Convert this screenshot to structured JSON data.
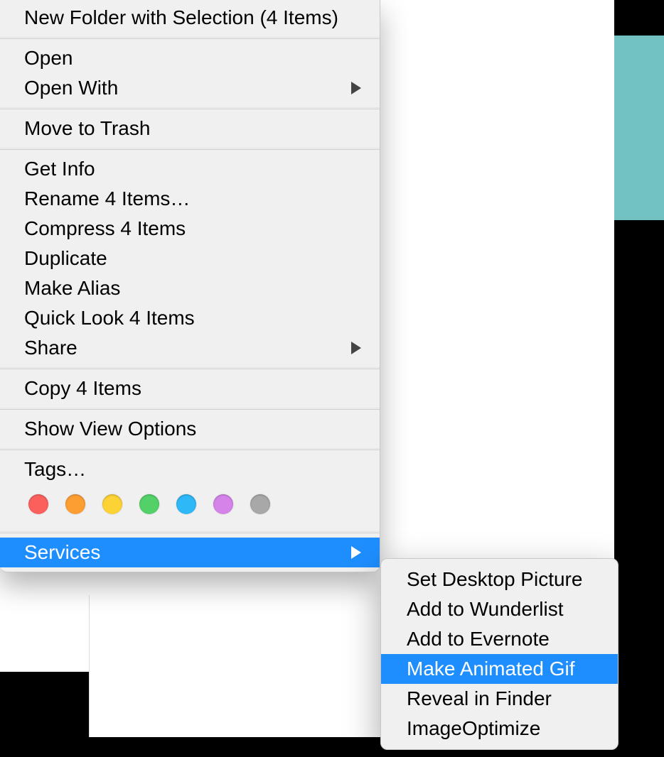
{
  "mainMenu": {
    "newFolder": "New Folder with Selection (4 Items)",
    "open": "Open",
    "openWith": "Open With",
    "moveToTrash": "Move to Trash",
    "getInfo": "Get Info",
    "rename": "Rename 4 Items…",
    "compress": "Compress 4 Items",
    "duplicate": "Duplicate",
    "makeAlias": "Make Alias",
    "quickLook": "Quick Look 4 Items",
    "share": "Share",
    "copy": "Copy 4 Items",
    "showViewOptions": "Show View Options",
    "tags": "Tags…",
    "services": "Services"
  },
  "tagColors": [
    "#fc605c",
    "#fd9e33",
    "#fdd235",
    "#53d168",
    "#2fb8f7",
    "#d583e9",
    "#a8a8a8"
  ],
  "subMenu": {
    "setDesktop": "Set Desktop Picture",
    "addWunderlist": "Add to Wunderlist",
    "addEvernote": "Add to Evernote",
    "makeGif": "Make Animated Gif",
    "revealFinder": "Reveal in Finder",
    "imageOptimize": "ImageOptimize"
  }
}
